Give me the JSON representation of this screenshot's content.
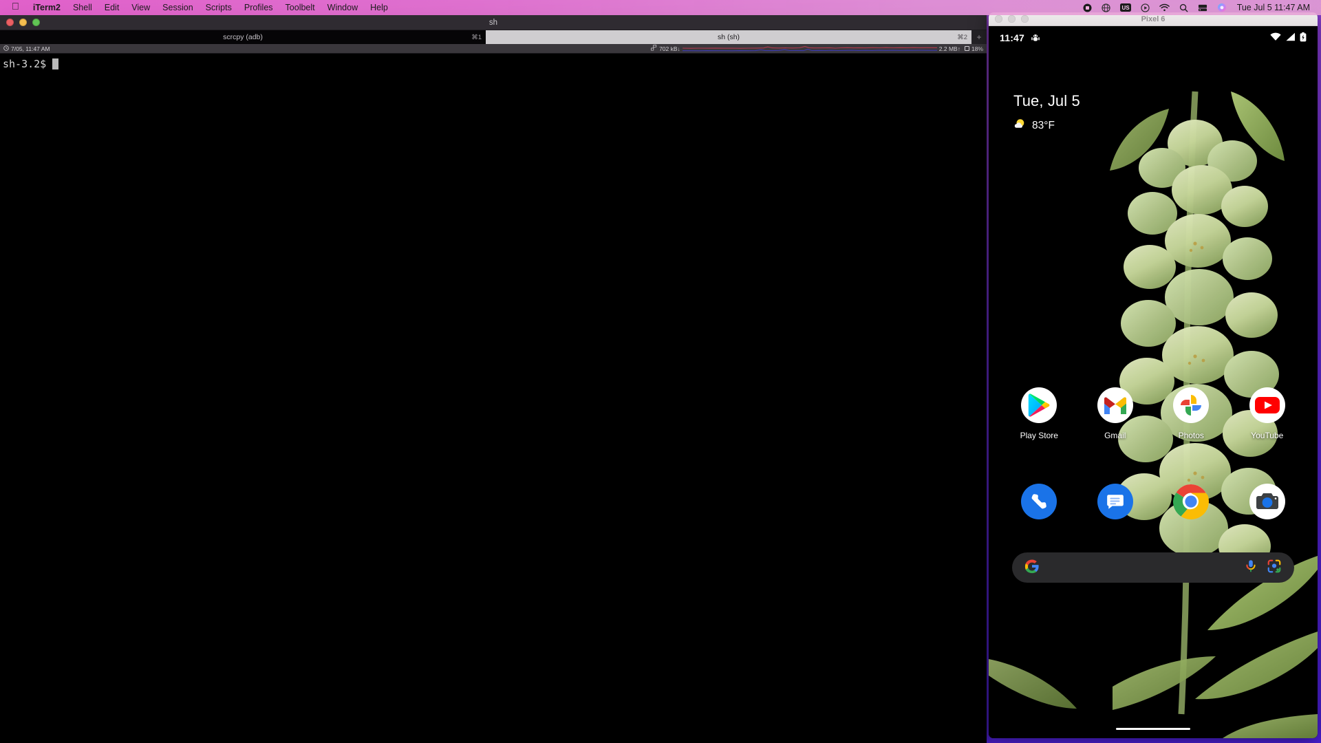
{
  "menubar": {
    "apple_icon": "apple-logo",
    "items": [
      {
        "label": "iTerm2",
        "bold": true
      },
      {
        "label": "Shell",
        "bold": false
      },
      {
        "label": "Edit",
        "bold": false
      },
      {
        "label": "View",
        "bold": false
      },
      {
        "label": "Session",
        "bold": false
      },
      {
        "label": "Scripts",
        "bold": false
      },
      {
        "label": "Profiles",
        "bold": false
      },
      {
        "label": "Toolbelt",
        "bold": false
      },
      {
        "label": "Window",
        "bold": false
      },
      {
        "label": "Help",
        "bold": false
      }
    ],
    "status_icons": [
      "record-indicator-icon",
      "globe-icon",
      "input-source-us-icon",
      "media-play-icon",
      "wifi-icon",
      "spotlight-search-icon",
      "screen-sharing-icon",
      "siri-icon"
    ],
    "input_source": "US",
    "clock": "Tue Jul 5  11:47 AM"
  },
  "iterm": {
    "window_title": "sh",
    "traffic_lights": [
      "close-button",
      "minimize-button",
      "maximize-button"
    ],
    "tabs": [
      {
        "label": "scrcpy (adb)",
        "shortcut": "⌘1",
        "active": false
      },
      {
        "label": "sh (sh)",
        "shortcut": "⌘2",
        "active": true
      }
    ],
    "new_tab_label": "+",
    "status_bar": {
      "clock_icon": "clock-icon",
      "clock": "7/05, 11:47 AM",
      "network_icon": "network-icon",
      "download": "702 kB↓",
      "upload": "2.2 MB↑",
      "memory_icon": "memory-box-icon",
      "memory": "18%"
    },
    "terminal": {
      "prompt": "sh-3.2$",
      "cursor": "block-cursor"
    }
  },
  "scrcpy": {
    "window_title": "Pixel 6",
    "traffic_lights": [
      "close-button",
      "minimize-button",
      "maximize-button"
    ],
    "android": {
      "status_bar": {
        "time": "11:47",
        "left_icon": "android-debug-bug-icon",
        "right_icons": [
          "wifi-icon",
          "cellular-signal-icon",
          "battery-icon"
        ]
      },
      "widget": {
        "date": "Tue, Jul 5",
        "weather_icon": "partly-sunny-icon",
        "temperature": "83°F"
      },
      "apps": [
        {
          "label": "Play Store",
          "icon": "play-store-icon"
        },
        {
          "label": "Gmail",
          "icon": "gmail-icon"
        },
        {
          "label": "Photos",
          "icon": "google-photos-icon"
        },
        {
          "label": "YouTube",
          "icon": "youtube-icon"
        }
      ],
      "dock": [
        {
          "name": "Phone",
          "icon": "phone-icon"
        },
        {
          "name": "Messages",
          "icon": "messages-icon"
        },
        {
          "name": "Chrome",
          "icon": "chrome-icon"
        },
        {
          "name": "Camera",
          "icon": "camera-icon"
        }
      ],
      "search": {
        "logo_icon": "google-g-icon",
        "placeholder": "",
        "mic_icon": "microphone-icon",
        "lens_icon": "google-lens-icon"
      },
      "gesture_bar": "home-gesture-bar"
    }
  },
  "colors": {
    "menubar_pink": "#ec78d0",
    "desktop_purple": "#5524d6",
    "iterm_bg": "#000000",
    "tab_active_bg": "#cfcdd0",
    "net_down_line": "#b33a4e",
    "net_up_line": "#3a3ab3"
  }
}
